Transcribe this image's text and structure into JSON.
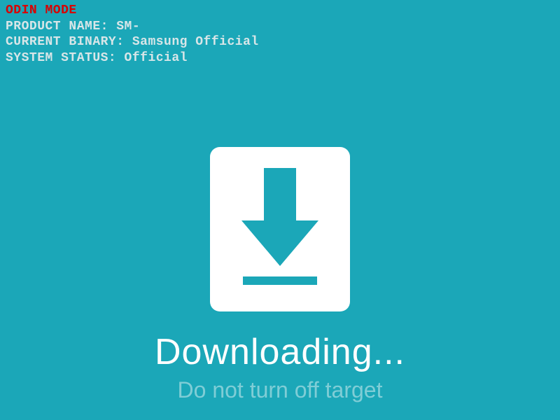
{
  "header": {
    "mode": "ODIN MODE",
    "product_label": "PRODUCT NAME:",
    "product_value": "SM-",
    "binary_label": "CURRENT BINARY:",
    "binary_value": "Samsung Official",
    "system_label": "SYSTEM STATUS:",
    "system_value": "Official"
  },
  "main": {
    "status": "Downloading...",
    "warning": "Do not turn off target"
  },
  "colors": {
    "background": "#1ba7b8",
    "mode_text": "#d80000",
    "info_text": "#d8e6e8",
    "status_text": "#ffffff",
    "warning_text": "#7fcdd6",
    "icon_bg": "#ffffff"
  }
}
